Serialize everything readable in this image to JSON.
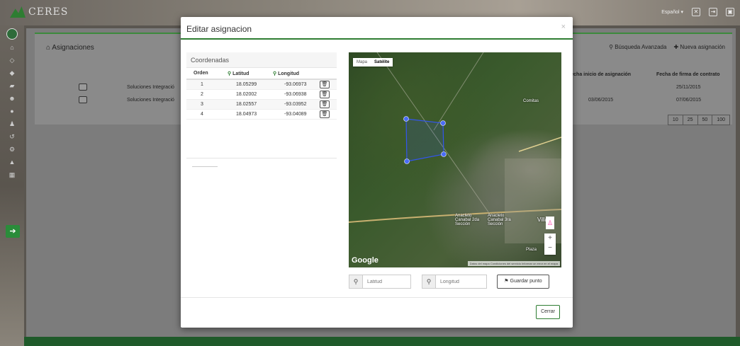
{
  "app": {
    "brand": "CERES",
    "language": "Español"
  },
  "page": {
    "title": "Asignaciones",
    "advanced_search": "Búsqueda Avanzada",
    "new_assignment": "Nueva asignación",
    "columns": [
      "Fecha inicio de asignación",
      "Fecha de firma de contrato"
    ],
    "rows": [
      {
        "company": "Soluciones Integració",
        "start_date": "",
        "sign_date": "25/11/2015"
      },
      {
        "company": "Soluciones Integració",
        "start_date": "03/06/2015",
        "sign_date": "07/06/2015"
      }
    ],
    "page_sizes": [
      "10",
      "25",
      "50",
      "100"
    ]
  },
  "modal": {
    "title": "Editar asignacion",
    "close": "×",
    "coords": {
      "title": "Coordenadas",
      "headers": {
        "order": "Orden",
        "lat": "Latitud",
        "lng": "Longitud"
      },
      "rows": [
        {
          "order": "1",
          "lat": "18.05299",
          "lng": "-93.06973"
        },
        {
          "order": "2",
          "lat": "18.02002",
          "lng": "-93.06938"
        },
        {
          "order": "3",
          "lat": "18.02557",
          "lng": "-93.03952"
        },
        {
          "order": "4",
          "lat": "18.04973",
          "lng": "-93.04089"
        }
      ]
    },
    "map": {
      "tab_map": "Mapa",
      "tab_satellite": "Satélite",
      "provider": "Google",
      "attribution": "Datos del mapa  Condiciones del servicio  Informar un error en el mapa",
      "labels": [
        "Comitas",
        "Villahe",
        "Plaza",
        "Anacleto Canabal 2da Sección",
        "Anacleto Canabal 3ra Sección"
      ]
    },
    "inputs": {
      "lat_placeholder": "Latitud",
      "lng_placeholder": "Longitud"
    },
    "save_point": "Guardar punto",
    "close_button": "Cerrar"
  },
  "colors": {
    "accent": "#2e7d32",
    "polygon": "#3355ee"
  }
}
